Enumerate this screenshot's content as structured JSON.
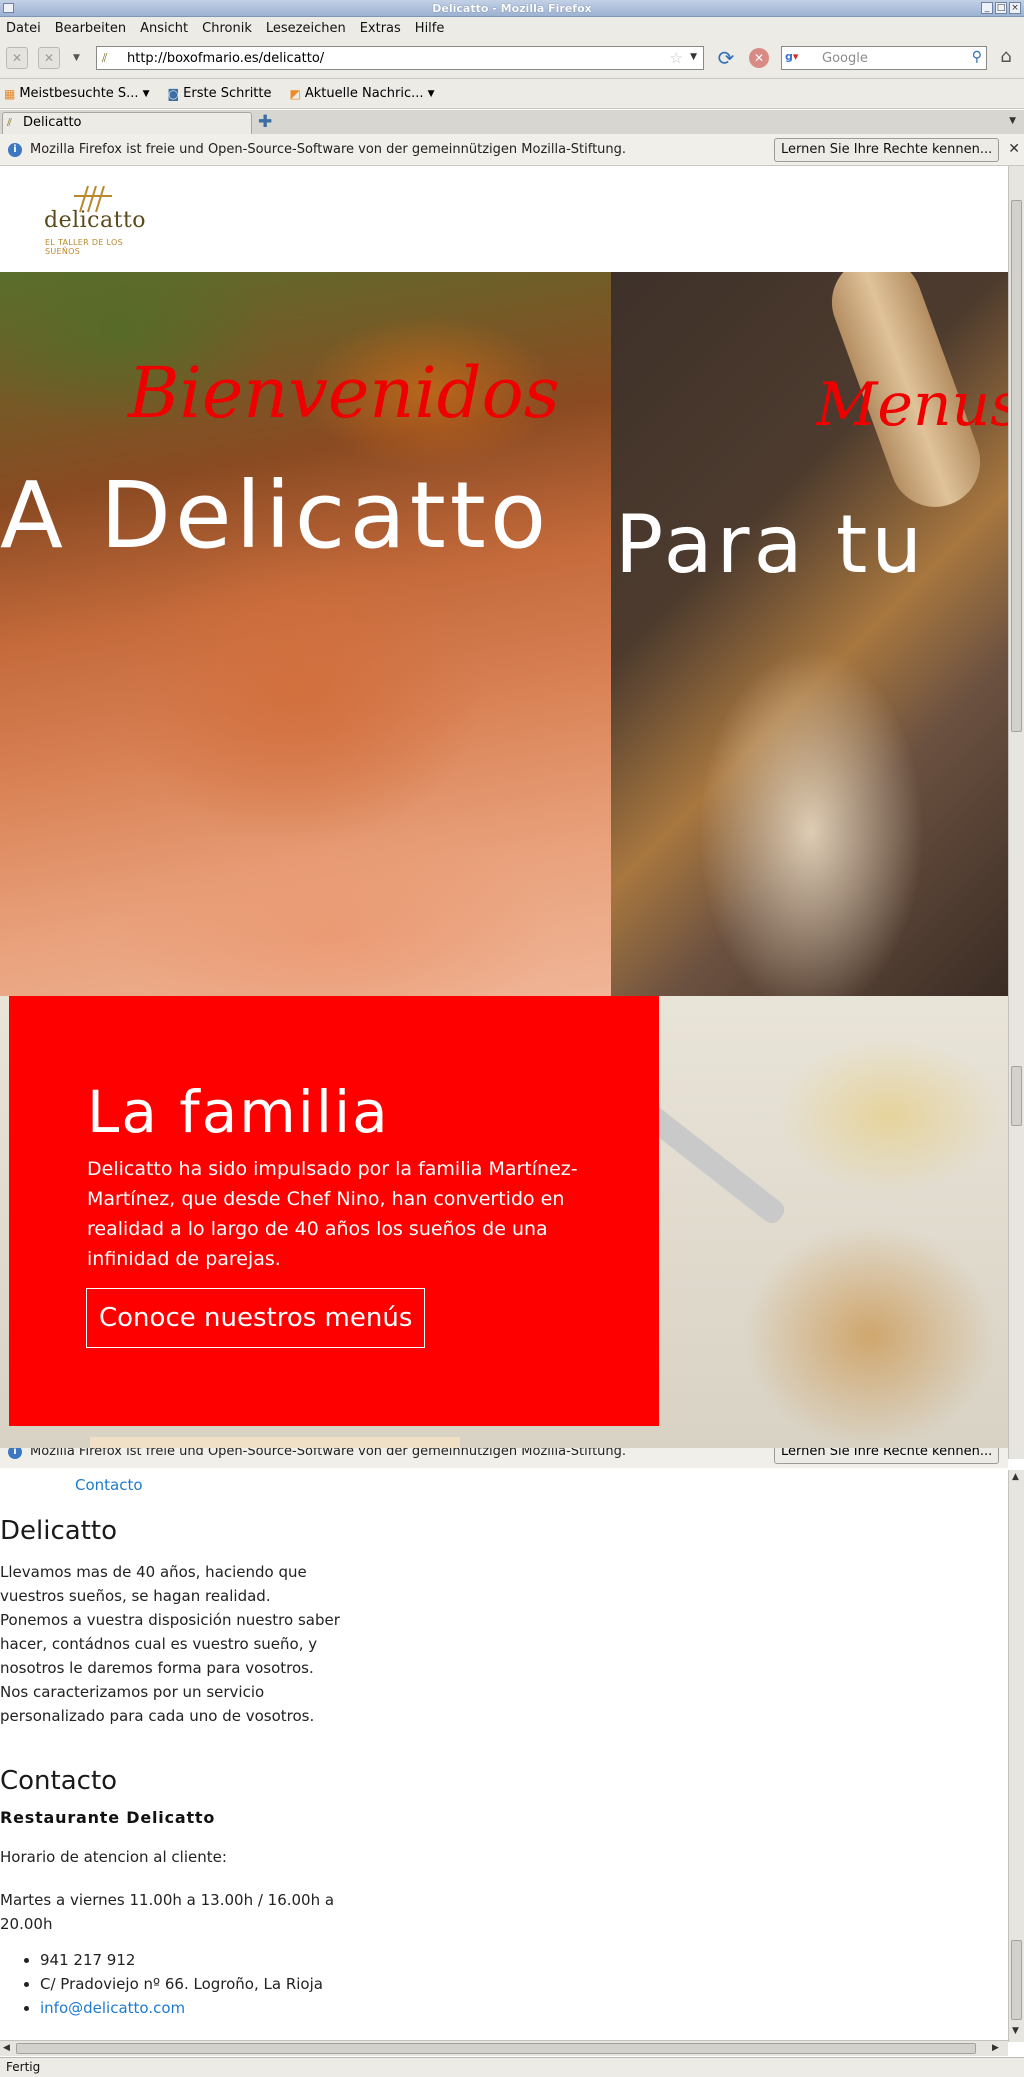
{
  "window": {
    "title": "Delicatto - Mozilla Firefox"
  },
  "menubar": {
    "items": [
      "Datei",
      "Bearbeiten",
      "Ansicht",
      "Chronik",
      "Lesezeichen",
      "Extras",
      "Hilfe"
    ]
  },
  "navbar": {
    "url": "http://boxofmario.es/delicatto/",
    "search_placeholder": "Google"
  },
  "bookmarks": {
    "items": [
      "Meistbesuchte S...",
      "Erste Schritte",
      "Aktuelle Nachric..."
    ]
  },
  "tabs": {
    "active_label": "Delicatto"
  },
  "infobar": {
    "message": "Mozilla Firefox ist freie und Open-Source-Software von der gemeinnützigen Mozilla-Stiftung.",
    "button_label": "Lernen Sie Ihre Rechte kennen..."
  },
  "site": {
    "logo_word": "delicatto",
    "logo_tagline": "EL TALLER DE LOS SUEÑOS",
    "slides": [
      {
        "script": "Bienvenidos",
        "headline": "A Delicatto"
      },
      {
        "script": "Menus",
        "headline": "Para tu"
      }
    ],
    "about": {
      "heading": "La familia",
      "text": "Delicatto ha sido impulsado por la familia Martínez-Martínez, que desde Chef Nino, han convertido en realidad a lo largo de 40 años los sueños de una infinidad de parejas.",
      "cta": "Conoce nuestros menús"
    }
  },
  "second_view": {
    "nav_contact": "Contacto",
    "delicatto_heading": "Delicatto",
    "delicatto_text": "Llevamos mas de 40 años, haciendo que vuestros sueños, se hagan realidad. Ponemos a vuestra disposición nuestro saber hacer, contádnos cual es vuestro sueño, y nosotros le daremos forma para vosotros. Nos caracterizamos por un servicio personalizado para cada uno de vosotros.",
    "contact_heading": "Contacto",
    "restaurant_name": "Restaurante Delicatto",
    "hours_label": "Horario de atencion al cliente:",
    "hours": "Martes a viernes 11.00h a 13.00h / 16.00h a 20.00h",
    "phone": "941 217 912",
    "address": "C/ Pradoviejo nº 66. Logroño, La Rioja",
    "email": "info@delicatto.com"
  },
  "statusbar": {
    "text": "Fertig"
  },
  "colors": {
    "accent_red": "#ff0000",
    "script_red": "#ee0000",
    "link_blue": "#1e7ad0"
  }
}
